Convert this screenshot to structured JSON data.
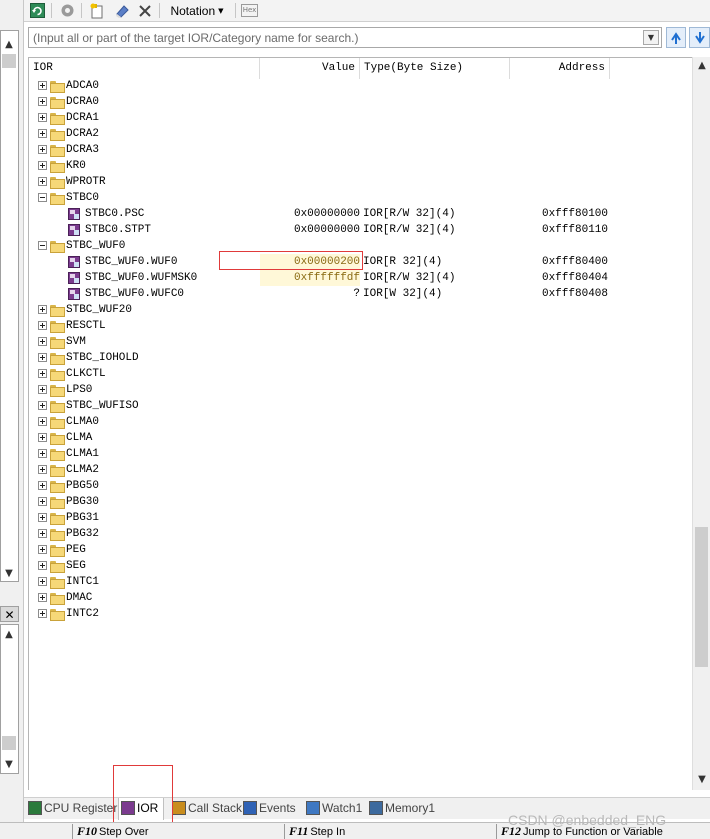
{
  "toolbar": {
    "notation_label": "Notation",
    "hex_label": "Hex"
  },
  "search": {
    "placeholder": "(Input all or part of the target IOR/Category name for search.)"
  },
  "columns": {
    "ior": "IOR",
    "value": "Value",
    "type": "Type(Byte Size)",
    "address": "Address"
  },
  "rows": [
    {
      "name": "ADCA0",
      "kind": "category",
      "expanded": false
    },
    {
      "name": "DCRA0",
      "kind": "category",
      "expanded": false
    },
    {
      "name": "DCRA1",
      "kind": "category",
      "expanded": false
    },
    {
      "name": "DCRA2",
      "kind": "category",
      "expanded": false
    },
    {
      "name": "DCRA3",
      "kind": "category",
      "expanded": false
    },
    {
      "name": "KR0",
      "kind": "category",
      "expanded": false
    },
    {
      "name": "WPROTR",
      "kind": "category",
      "expanded": false
    },
    {
      "name": "STBC0",
      "kind": "category",
      "expanded": true
    },
    {
      "name": "STBC0.PSC",
      "kind": "register",
      "value": "0x00000000",
      "type": "IOR[R/W 32](4)",
      "address": "0xfff80100"
    },
    {
      "name": "STBC0.STPT",
      "kind": "register",
      "value": "0x00000000",
      "type": "IOR[R/W 32](4)",
      "address": "0xfff80110"
    },
    {
      "name": "STBC_WUF0",
      "kind": "category",
      "expanded": true
    },
    {
      "name": "STBC_WUF0.WUF0",
      "kind": "register",
      "value": "0x00000200",
      "type": "IOR[R 32](4)",
      "address": "0xfff80400",
      "highlight": true
    },
    {
      "name": "STBC_WUF0.WUFMSK0",
      "kind": "register",
      "value": "0xffffffdf",
      "type": "IOR[R/W 32](4)",
      "address": "0xfff80404",
      "highlight": true
    },
    {
      "name": "STBC_WUF0.WUFC0",
      "kind": "register",
      "value": "?",
      "type": "IOR[W 32](4)",
      "address": "0xfff80408"
    },
    {
      "name": "STBC_WUF20",
      "kind": "category",
      "expanded": false
    },
    {
      "name": "RESCTL",
      "kind": "category",
      "expanded": false
    },
    {
      "name": "SVM",
      "kind": "category",
      "expanded": false
    },
    {
      "name": "STBC_IOHOLD",
      "kind": "category",
      "expanded": false
    },
    {
      "name": "CLKCTL",
      "kind": "category",
      "expanded": false
    },
    {
      "name": "LPS0",
      "kind": "category",
      "expanded": false
    },
    {
      "name": "STBC_WUFISO",
      "kind": "category",
      "expanded": false
    },
    {
      "name": "CLMA0",
      "kind": "category",
      "expanded": false
    },
    {
      "name": "CLMA",
      "kind": "category",
      "expanded": false
    },
    {
      "name": "CLMA1",
      "kind": "category",
      "expanded": false
    },
    {
      "name": "CLMA2",
      "kind": "category",
      "expanded": false
    },
    {
      "name": "PBG50",
      "kind": "category",
      "expanded": false
    },
    {
      "name": "PBG30",
      "kind": "category",
      "expanded": false
    },
    {
      "name": "PBG31",
      "kind": "category",
      "expanded": false
    },
    {
      "name": "PBG32",
      "kind": "category",
      "expanded": false
    },
    {
      "name": "PEG",
      "kind": "category",
      "expanded": false
    },
    {
      "name": "SEG",
      "kind": "category",
      "expanded": false
    },
    {
      "name": "INTC1",
      "kind": "category",
      "expanded": false
    },
    {
      "name": "DMAC",
      "kind": "category",
      "expanded": false
    },
    {
      "name": "INTC2",
      "kind": "category",
      "expanded": false
    }
  ],
  "tabs": [
    {
      "label": "CPU Register",
      "icon": "cpu-register-icon",
      "active": false
    },
    {
      "label": "IOR",
      "icon": "ior-icon",
      "active": true
    },
    {
      "label": "Call Stack",
      "icon": "call-stack-icon",
      "active": false
    },
    {
      "label": "Events",
      "icon": "events-icon",
      "active": false
    },
    {
      "label": "Watch1",
      "icon": "watch-icon",
      "active": false
    },
    {
      "label": "Memory1",
      "icon": "memory-icon",
      "active": false
    }
  ],
  "status": {
    "f10_key": "F10",
    "f10_label": "Step Over",
    "f11_key": "F11",
    "f11_label": "Step In",
    "f12_key": "F12",
    "f12_label": "Jump to Function or Variable"
  },
  "watermark": "CSDN @enbedded_ENG",
  "colors": {
    "highlight_box": "#e03a3a",
    "changed_value_bg": "#fff8d8",
    "changed_value_text": "#8a6a12",
    "register_icon": "#7b3b8f",
    "folder_icon": "#f6d878"
  }
}
